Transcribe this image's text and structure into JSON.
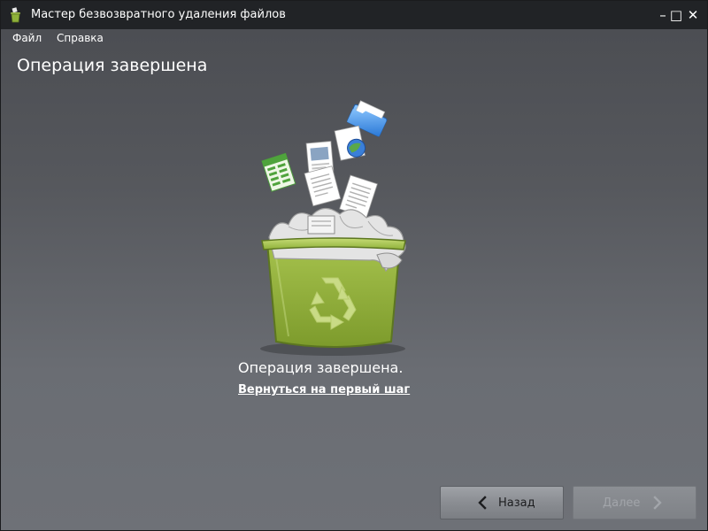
{
  "window": {
    "title": "Мастер безвозвратного удаления файлов",
    "minimize": "–",
    "maximize": "□",
    "close": "✕",
    "app_icon": "trash-bin-icon"
  },
  "menu": {
    "file": "Файл",
    "help": "Справка"
  },
  "page": {
    "title": "Операция завершена"
  },
  "main": {
    "illustration": "trash-bin-with-files-icon",
    "status": "Операция завершена.",
    "link": "Вернуться на первый шаг"
  },
  "footer": {
    "back_label": "Назад",
    "next_label": "Далее",
    "next_enabled": false,
    "back_icon": "chevron-left-icon",
    "next_icon": "chevron-right-icon"
  },
  "colors": {
    "accent_green": "#8fb13a",
    "titlebar": "#212326"
  }
}
